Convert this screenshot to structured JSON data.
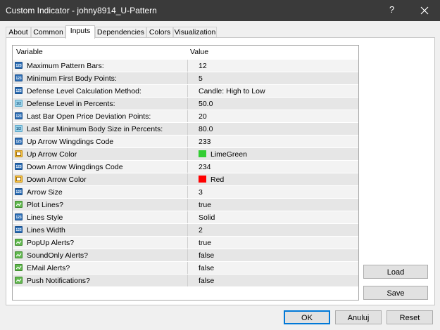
{
  "window": {
    "title": "Custom Indicator - johny8914_U-Pattern",
    "help": "?"
  },
  "tabs": [
    "About",
    "Common",
    "Inputs",
    "Dependencies",
    "Colors",
    "Visualization"
  ],
  "active_tab": "Inputs",
  "grid": {
    "col_variable": "Variable",
    "col_value": "Value",
    "rows": [
      {
        "icon": "int",
        "variable": "Maximum Pattern Bars:",
        "value": "12"
      },
      {
        "icon": "int",
        "variable": "Minimum First Body Points:",
        "value": "5"
      },
      {
        "icon": "int",
        "variable": "Defense Level Calculation Method:",
        "value": "Candle: High to Low"
      },
      {
        "icon": "dbl",
        "variable": "Defense Level in Percents:",
        "value": "50.0"
      },
      {
        "icon": "int",
        "variable": "Last Bar Open Price Deviation Points:",
        "value": "20"
      },
      {
        "icon": "dbl",
        "variable": "Last Bar Minimum Body Size in Percents:",
        "value": "80.0"
      },
      {
        "icon": "int",
        "variable": "Up Arrow Wingdings Code",
        "value": "233"
      },
      {
        "icon": "clr",
        "variable": "Up Arrow Color",
        "value": "LimeGreen",
        "swatch": "#32cd32"
      },
      {
        "icon": "int",
        "variable": "Down Arrow Wingdings Code",
        "value": "234"
      },
      {
        "icon": "clr",
        "variable": "Down Arrow Color",
        "value": "Red",
        "swatch": "#ff0000"
      },
      {
        "icon": "int",
        "variable": "Arrow Size",
        "value": "3"
      },
      {
        "icon": "bool",
        "variable": "Plot Lines?",
        "value": "true"
      },
      {
        "icon": "int",
        "variable": "Lines Style",
        "value": "Solid"
      },
      {
        "icon": "int",
        "variable": "Lines Width",
        "value": "2"
      },
      {
        "icon": "bool",
        "variable": "PopUp Alerts?",
        "value": "true"
      },
      {
        "icon": "bool",
        "variable": "SoundOnly Alerts?",
        "value": "false"
      },
      {
        "icon": "bool",
        "variable": "EMail Alerts?",
        "value": "false"
      },
      {
        "icon": "bool",
        "variable": "Push Notifications?",
        "value": "false"
      }
    ]
  },
  "side_buttons": {
    "load": "Load",
    "save": "Save"
  },
  "footer_buttons": {
    "ok": "OK",
    "cancel": "Anuluj",
    "reset": "Reset"
  },
  "colors": {
    "titlebar": "#3a3a3a",
    "accent": "#0078d7"
  }
}
